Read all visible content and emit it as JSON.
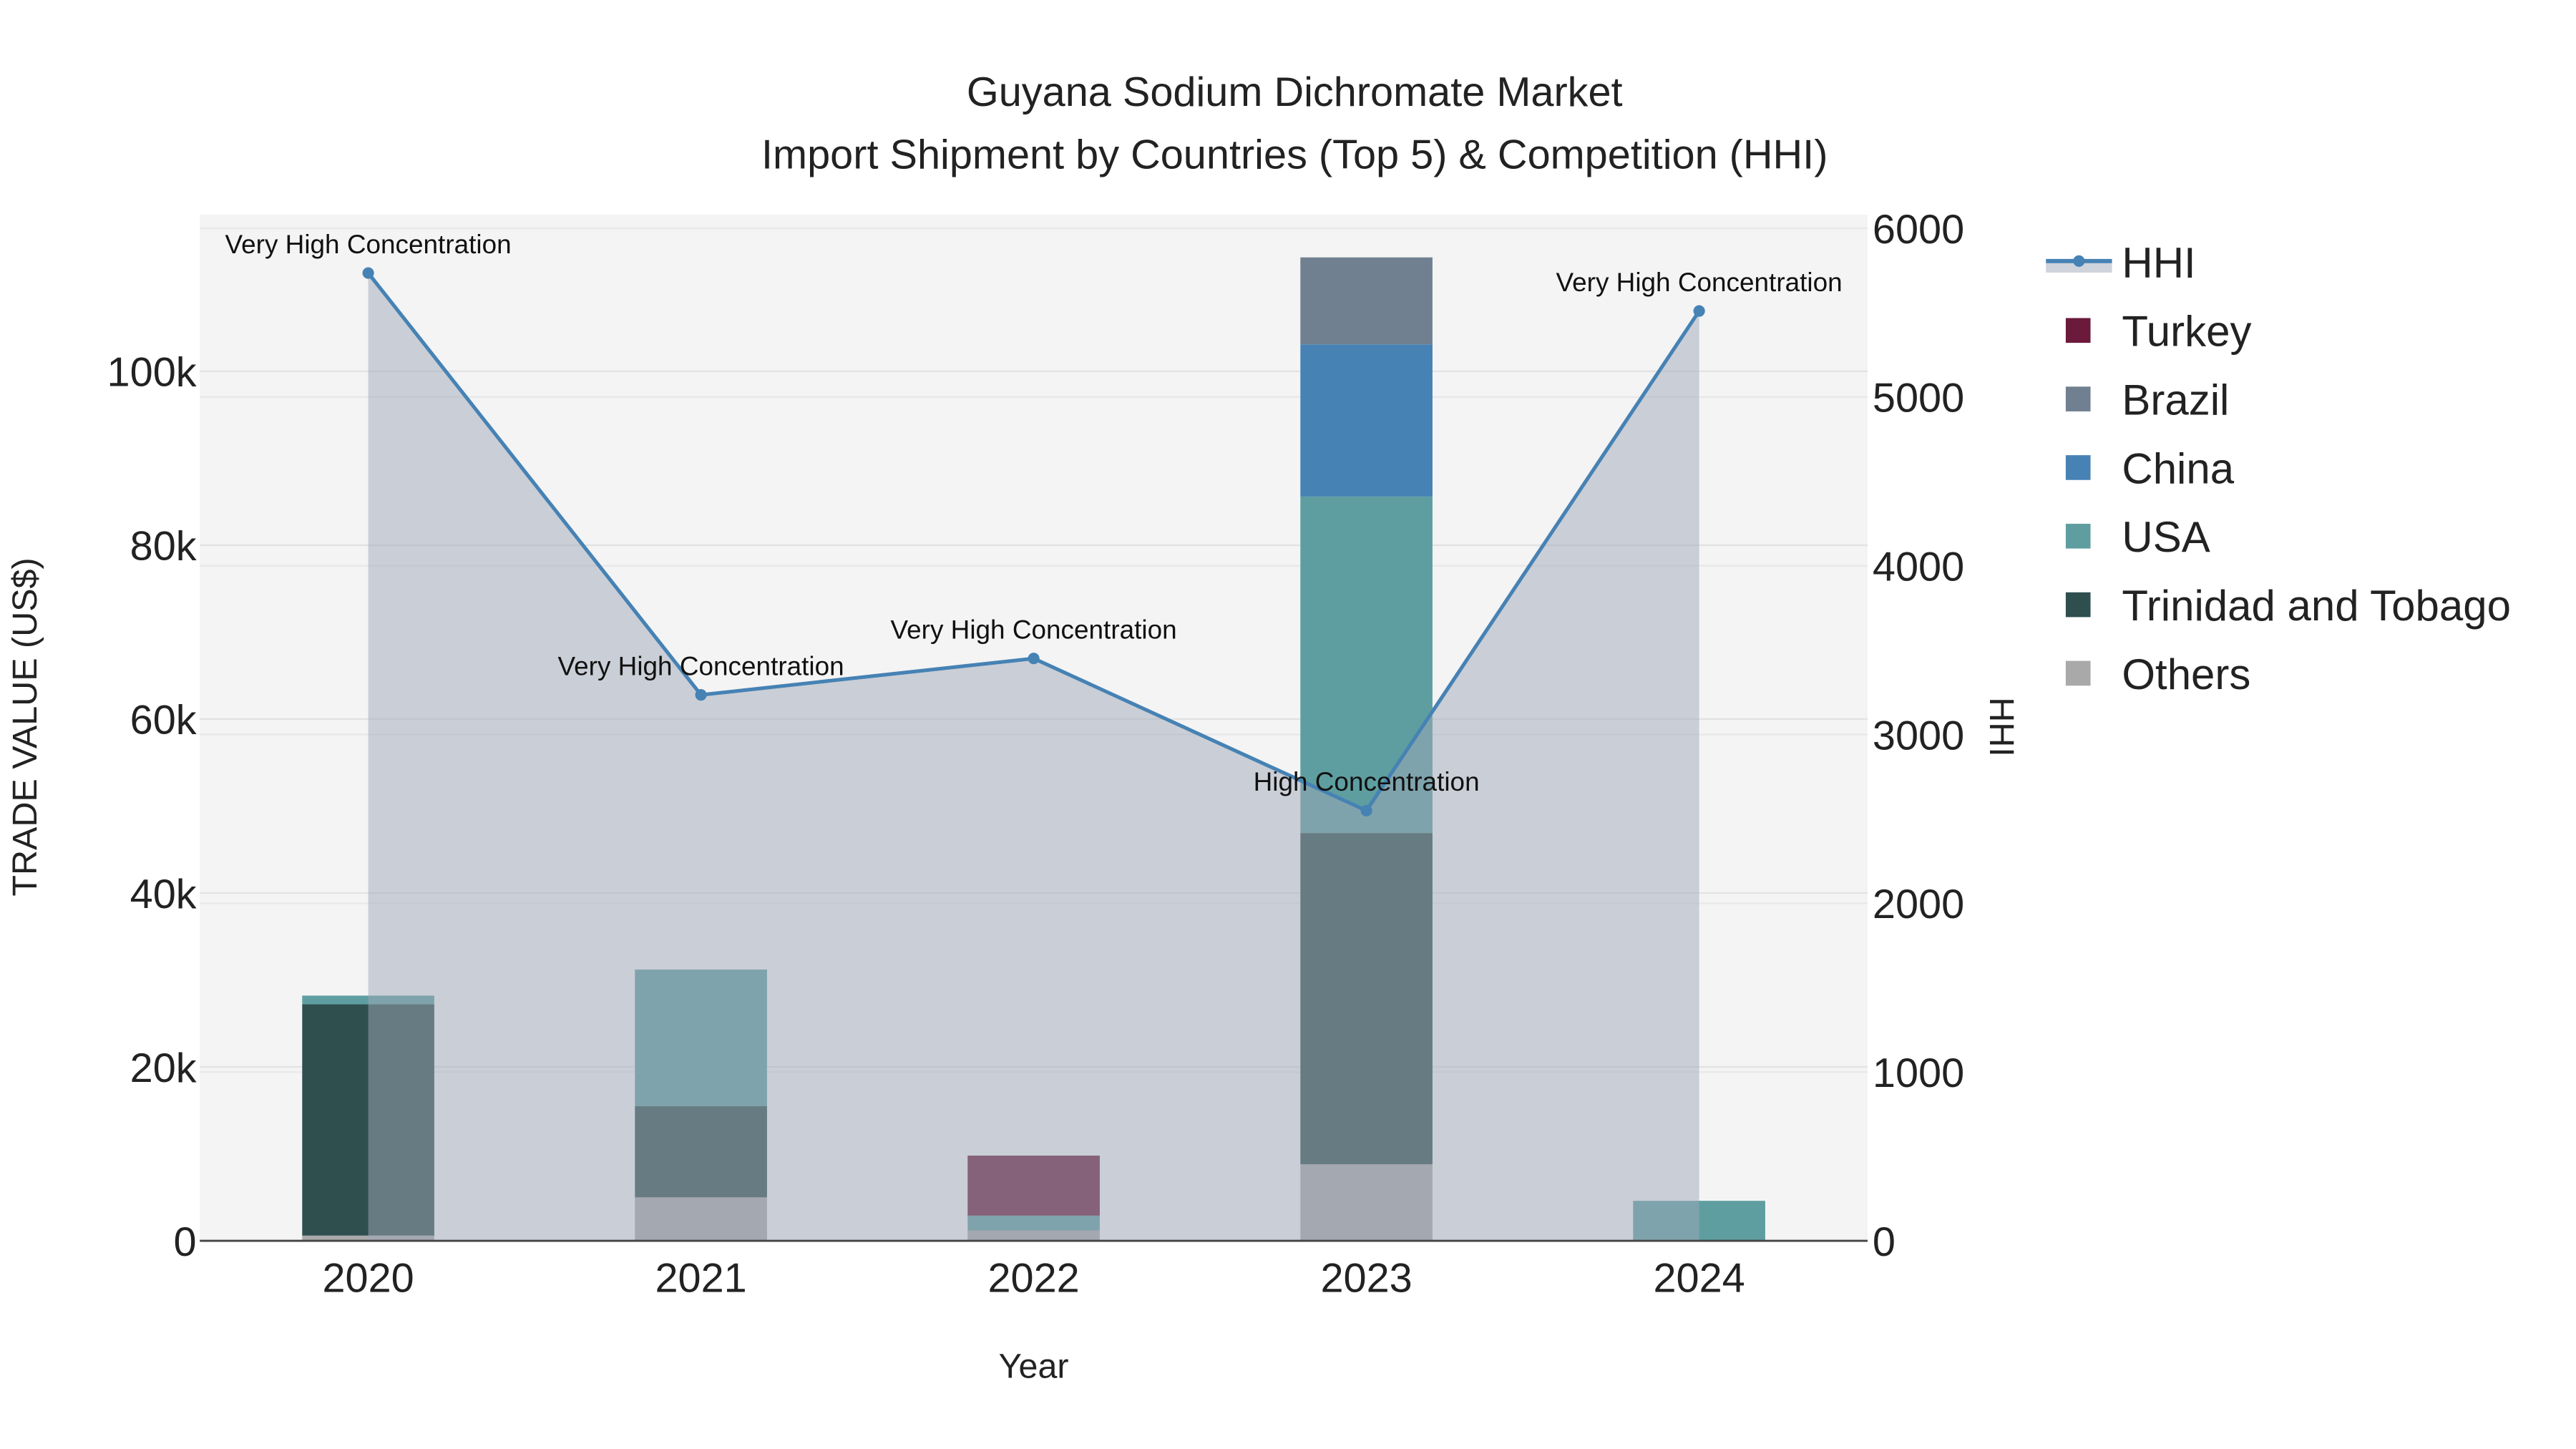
{
  "chart_data": {
    "type": "bar",
    "title_line1": "Guyana Sodium Dichromate Market",
    "title_line2": "Import Shipment by Countries (Top 5) & Competition (HHI)",
    "xlabel": "Year",
    "ylabel": "TRADE VALUE (US$)",
    "y2label": "HHI",
    "categories": [
      "2020",
      "2021",
      "2022",
      "2023",
      "2024"
    ],
    "ylim": [
      0,
      118000
    ],
    "y2lim": [
      0,
      6080
    ],
    "yticks": [
      {
        "v": 0,
        "label": "0"
      },
      {
        "v": 20000,
        "label": "20k"
      },
      {
        "v": 40000,
        "label": "40k"
      },
      {
        "v": 60000,
        "label": "60k"
      },
      {
        "v": 80000,
        "label": "80k"
      },
      {
        "v": 100000,
        "label": "100k"
      }
    ],
    "y2ticks": [
      {
        "v": 0,
        "label": "0"
      },
      {
        "v": 1000,
        "label": "1000"
      },
      {
        "v": 2000,
        "label": "2000"
      },
      {
        "v": 3000,
        "label": "3000"
      },
      {
        "v": 4000,
        "label": "4000"
      },
      {
        "v": 5000,
        "label": "5000"
      },
      {
        "v": 6000,
        "label": "6000"
      }
    ],
    "stacked": true,
    "series": [
      {
        "name": "Others",
        "color": "#a9a9a9",
        "values": [
          600,
          5000,
          1200,
          8800,
          0
        ]
      },
      {
        "name": "Trinidad and Tobago",
        "color": "#2f4f4f",
        "values": [
          26600,
          10500,
          0,
          38100,
          0
        ]
      },
      {
        "name": "USA",
        "color": "#5f9ea0",
        "values": [
          1000,
          15700,
          1700,
          38700,
          4600
        ]
      },
      {
        "name": "China",
        "color": "#4682b4",
        "values": [
          0,
          0,
          0,
          17500,
          0
        ]
      },
      {
        "name": "Brazil",
        "color": "#708090",
        "values": [
          0,
          0,
          0,
          10000,
          0
        ]
      },
      {
        "name": "Turkey",
        "color": "#6b1a3c",
        "values": [
          0,
          0,
          6900,
          0,
          0
        ]
      }
    ],
    "hhi": {
      "name": "HHI",
      "color": "#4682b4",
      "values": [
        5735,
        3235,
        3451,
        2549,
        5510
      ],
      "annotations": [
        "Very High Concentration",
        "Very High Concentration",
        "Very High Concentration",
        "High Concentration",
        "Very High Concentration"
      ]
    },
    "legend_order": [
      "HHI",
      "Turkey",
      "Brazil",
      "China",
      "USA",
      "Trinidad and Tobago",
      "Others"
    ],
    "legend_placement": "right",
    "grid": true
  }
}
